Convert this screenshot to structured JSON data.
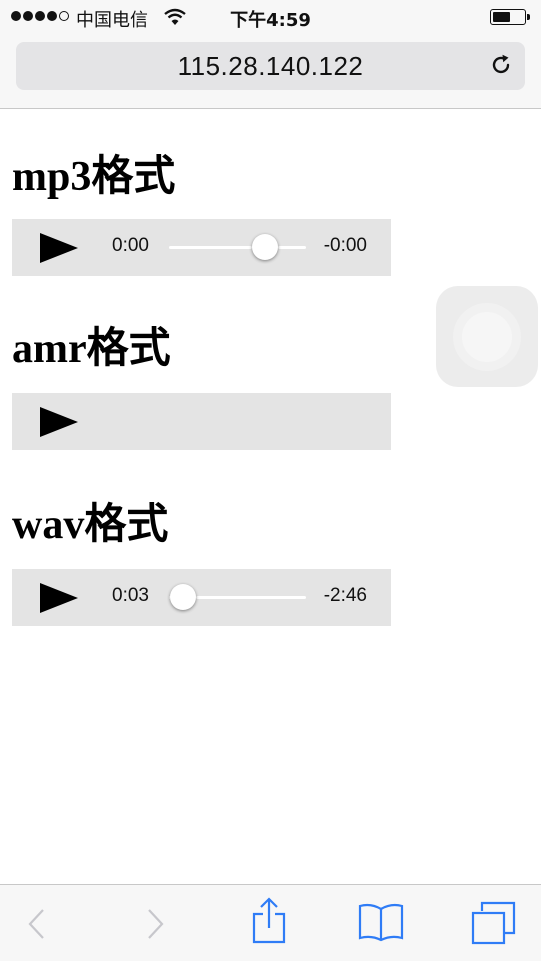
{
  "status_bar": {
    "carrier": "中国电信",
    "time": "下午4:59",
    "signal_bars": 4,
    "battery_level": 0.6
  },
  "browser": {
    "url": "115.28.140.122"
  },
  "sections": [
    {
      "heading": "mp3格式",
      "player": {
        "current_time": "0:00",
        "remaining_time": "-0:00",
        "progress": 0.7,
        "show_controls": true
      }
    },
    {
      "heading": "amr格式",
      "player": {
        "current_time": "",
        "remaining_time": "",
        "progress": 0,
        "show_controls": false
      }
    },
    {
      "heading": "wav格式",
      "player": {
        "current_time": "0:03",
        "remaining_time": "-2:46",
        "progress": 0.1,
        "show_controls": true
      }
    }
  ],
  "toolbar": {
    "icons": [
      "back-icon",
      "forward-icon",
      "share-icon",
      "bookmarks-icon",
      "tabs-icon"
    ]
  },
  "colors": {
    "accent": "#2f7cf6",
    "disabled": "#c7c7cc",
    "player_bg": "#e4e4e4"
  }
}
